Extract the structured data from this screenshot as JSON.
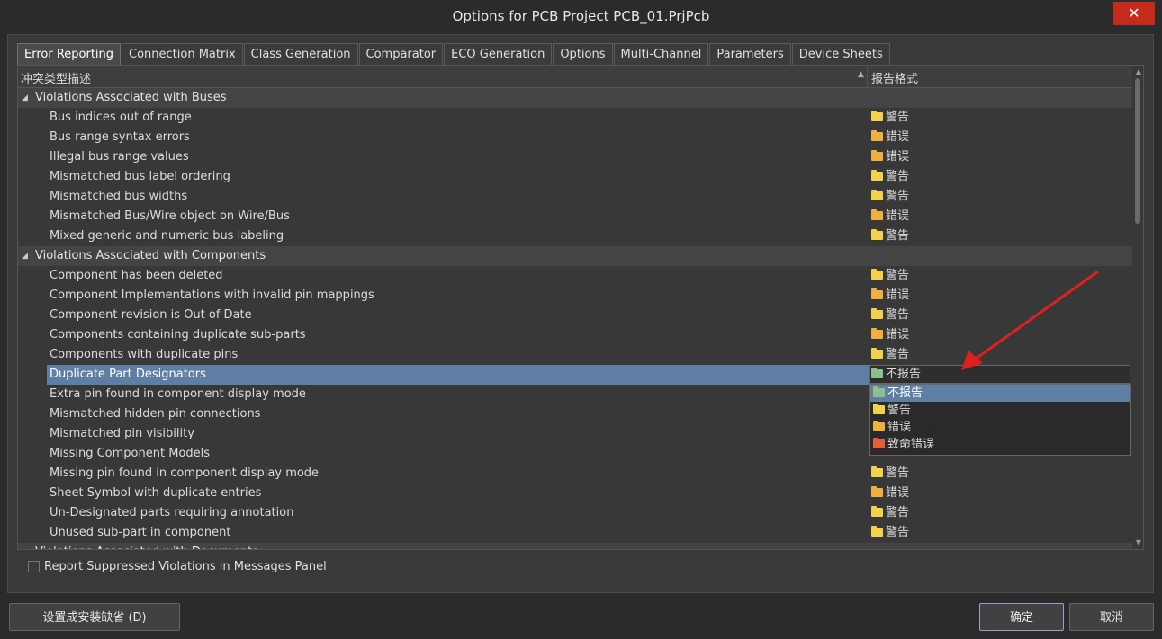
{
  "window": {
    "title": "Options for PCB Project PCB_01.PrjPcb",
    "close_glyph": "✕"
  },
  "tabs": [
    "Error Reporting",
    "Connection Matrix",
    "Class Generation",
    "Comparator",
    "ECO Generation",
    "Options",
    "Multi-Channel",
    "Parameters",
    "Device Sheets"
  ],
  "table": {
    "col_description": "冲突类型描述",
    "col_report": "报告格式",
    "groups": [
      {
        "label": "Violations Associated with Buses"
      },
      {
        "label": "Violations Associated with Components"
      },
      {
        "label": "Violations Associated with Documents"
      }
    ],
    "rows": [
      {
        "label": "Bus indices out of range",
        "status": "警告"
      },
      {
        "label": "Bus range syntax errors",
        "status": "错误"
      },
      {
        "label": "Illegal bus range values",
        "status": "错误"
      },
      {
        "label": "Mismatched bus label ordering",
        "status": "警告"
      },
      {
        "label": "Mismatched bus widths",
        "status": "警告"
      },
      {
        "label": "Mismatched Bus/Wire object on Wire/Bus",
        "status": "错误"
      },
      {
        "label": "Mixed generic and numeric bus labeling",
        "status": "警告"
      },
      {
        "label": "Component has been deleted",
        "status": "警告"
      },
      {
        "label": "Component Implementations with invalid pin mappings",
        "status": "错误"
      },
      {
        "label": "Component revision is Out of Date",
        "status": "警告"
      },
      {
        "label": "Components containing duplicate sub-parts",
        "status": "错误"
      },
      {
        "label": "Components with duplicate pins",
        "status": "警告"
      },
      {
        "label": "Duplicate Part Designators",
        "status": "不报告"
      },
      {
        "label": "Extra pin found in component display mode",
        "status": ""
      },
      {
        "label": "Mismatched hidden pin connections",
        "status": ""
      },
      {
        "label": "Mismatched pin visibility",
        "status": ""
      },
      {
        "label": "Missing Component Models",
        "status": ""
      },
      {
        "label": "Missing pin found in component display mode",
        "status": "警告"
      },
      {
        "label": "Sheet Symbol with duplicate entries",
        "status": "错误"
      },
      {
        "label": "Un-Designated parts requiring annotation",
        "status": "警告"
      },
      {
        "label": "Unused sub-part in component",
        "status": "警告"
      }
    ]
  },
  "dropdown": {
    "options": [
      "不报告",
      "警告",
      "错误",
      "致命错误"
    ],
    "selected": "不报告"
  },
  "colors": {
    "no_report": "#8fbf8f",
    "warning": "#f2d24a",
    "error": "#f0b040",
    "fatal": "#e0603a",
    "accent": "#5e7fa3",
    "arrow": "#e02020"
  },
  "footer": {
    "report_suppressed": "Report Suppressed Violations in Messages Panel",
    "set_default": "设置成安装缺省 (D)",
    "ok": "确定",
    "cancel": "取消"
  }
}
